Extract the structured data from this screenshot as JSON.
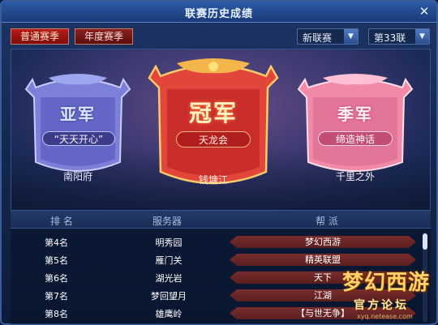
{
  "window": {
    "title": "联赛历史成绩",
    "close_glyph": "✕"
  },
  "tabs": [
    {
      "label": "普通赛季",
      "active": true
    },
    {
      "label": "年度赛季",
      "active": false
    }
  ],
  "filters": {
    "league_type": "新联赛",
    "league_number": "第33联",
    "arrow_glyph": "▼"
  },
  "podium": {
    "second": {
      "rank": "亚军",
      "guild": "“天天开心”",
      "server": "南阳府"
    },
    "first": {
      "rank": "冠军",
      "guild": "天龙会",
      "server": "钱塘江"
    },
    "third": {
      "rank": "季军",
      "guild": "缔造神话",
      "server": "千里之外"
    }
  },
  "table": {
    "headers": {
      "rank": "排 名",
      "server": "服务器",
      "guild": "帮 派"
    },
    "rows": [
      {
        "rank": "第4名",
        "server": "明秀园",
        "guild": "梦幻西游"
      },
      {
        "rank": "第5名",
        "server": "雁门关",
        "guild": "精英联盟"
      },
      {
        "rank": "第6名",
        "server": "湖光岩",
        "guild": "天下"
      },
      {
        "rank": "第7名",
        "server": "梦回望月",
        "guild": "江湖"
      },
      {
        "rank": "第8名",
        "server": "雄鹰岭",
        "guild": "【与世无争】"
      }
    ]
  },
  "watermark": {
    "logo": "梦幻西游",
    "subtitle": "官方论坛",
    "url": "xyq.netease.com"
  },
  "colors": {
    "accent": "#b71a1a",
    "frame": "#3a5d9c",
    "gold": "#ffd36a"
  }
}
